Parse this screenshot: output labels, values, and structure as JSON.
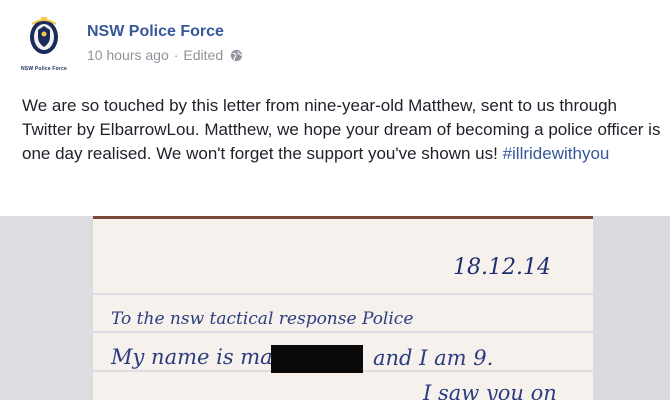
{
  "post": {
    "page_name": "NSW Police Force",
    "time": "10 hours ago",
    "separator": "·",
    "edited": "Edited",
    "avatar_caption": "NSW Police Force",
    "text_main": "We are so touched by this letter from nine-year-old Matthew, sent to us through Twitter by ElbarrowLou. Matthew, we hope your dream of becoming a police officer is one day realised. We won't forget the support you've shown us! ",
    "hashtag": "#illridewithyou"
  },
  "letter": {
    "date": "18.12.14",
    "line1": "To the nsw tactical response Police",
    "line2_start": "My name is matthew",
    "line2_end": "and I am 9.",
    "line3_partial": "I saw you on"
  },
  "icons": {
    "globe": "globe-icon",
    "badge": "police-badge-icon"
  },
  "colors": {
    "link": "#365899",
    "meta": "#90949c",
    "text": "#1d2129",
    "ink": "#2a3d7e"
  }
}
